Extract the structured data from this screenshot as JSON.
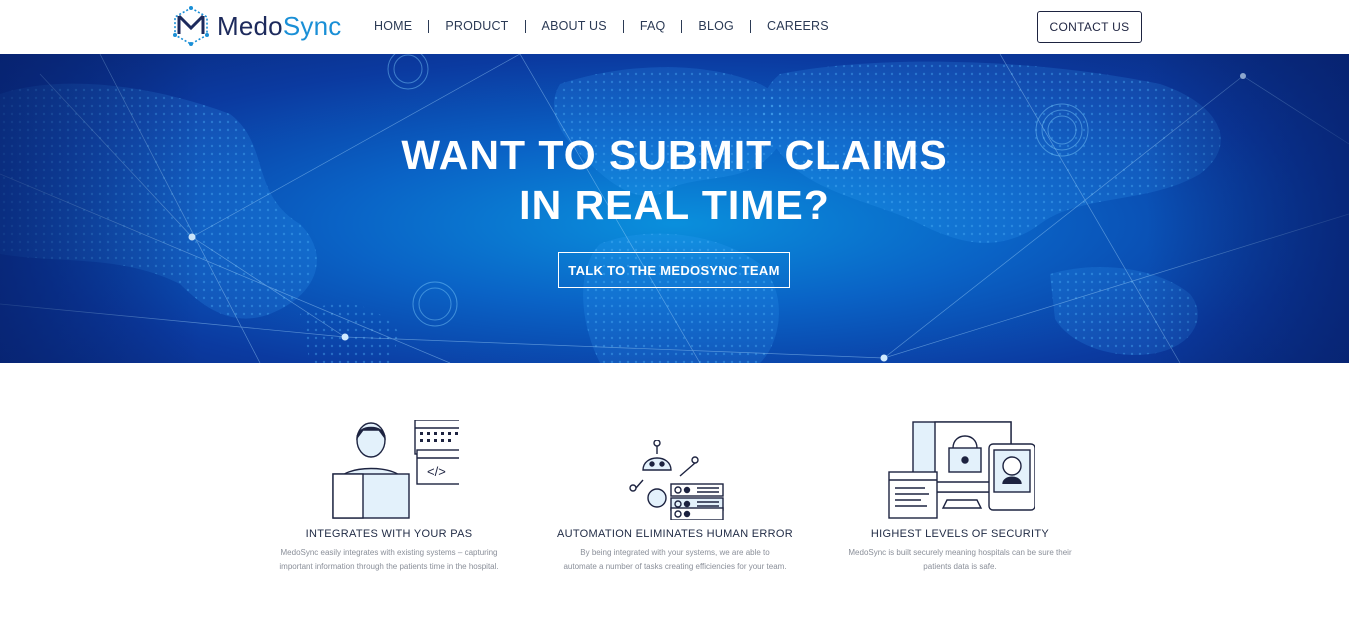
{
  "header": {
    "logo": {
      "part1": "Medo",
      "part2": "Sync"
    },
    "nav": [
      "HOME",
      "PRODUCT",
      "ABOUT US",
      "FAQ",
      "BLOG",
      "CAREERS"
    ],
    "contact_label": "CONTACT US"
  },
  "hero": {
    "title_line1": "WANT TO SUBMIT CLAIMS",
    "title_line2": "IN REAL TIME?",
    "cta_label": "TALK TO THE MEDOSYNC TEAM"
  },
  "features": [
    {
      "icon": "person-computer-icon",
      "title": "INTEGRATES WITH YOUR PAS",
      "description": "MedoSync easily integrates with existing systems – capturing important information through the patients time in the hospital."
    },
    {
      "icon": "robot-server-icon",
      "title": "AUTOMATION ELIMINATES HUMAN ERROR",
      "description": "By being integrated with your systems, we are able to automate a number of tasks creating efficiencies for your team."
    },
    {
      "icon": "secure-devices-icon",
      "title": "HIGHEST LEVELS OF SECURITY",
      "description": "MedoSync is built securely meaning hospitals can be sure their patients data is safe."
    }
  ],
  "colors": {
    "brand_dark": "#1d2a5c",
    "brand_accent": "#1a8fd6",
    "hero_blue": "#0a63c6"
  }
}
